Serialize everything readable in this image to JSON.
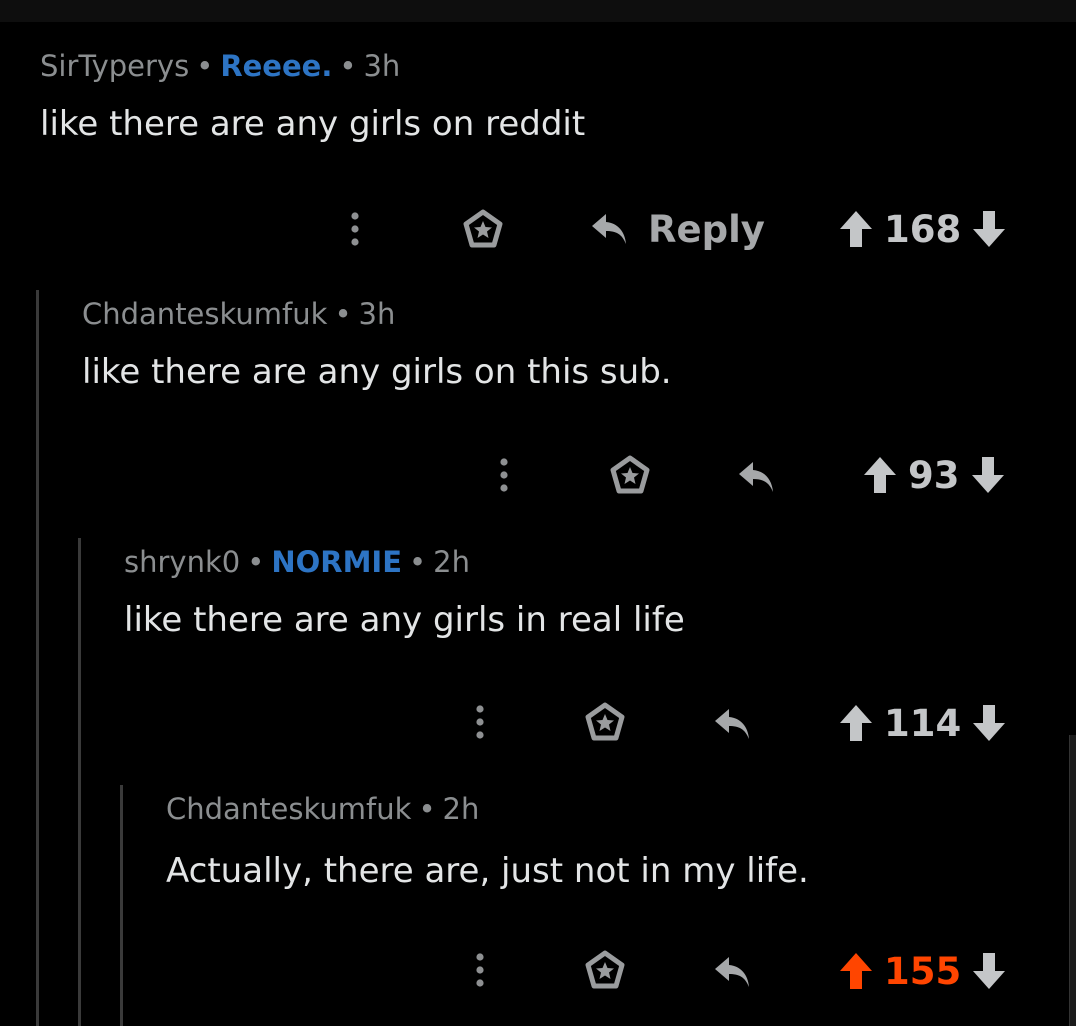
{
  "colors": {
    "background": "#000000",
    "flair": "#2d74c4",
    "upvote_active": "#ff4500",
    "muted": "#8b8e90"
  },
  "comments": [
    {
      "author": "SirTyperys",
      "flair": "Reeee.",
      "age": "3h",
      "body": "like there are any girls on reddit",
      "reply_label": "Reply",
      "score": "168",
      "upvoted": false
    },
    {
      "author": "Chdanteskumfuk",
      "flair": "",
      "age": "3h",
      "body": "like there are any girls on this sub.",
      "reply_label": "",
      "score": "93",
      "upvoted": false
    },
    {
      "author": "shrynk0",
      "flair": "NORMIE",
      "age": "2h",
      "body": "like there are any girls in real life",
      "reply_label": "",
      "score": "114",
      "upvoted": false
    },
    {
      "author": "Chdanteskumfuk",
      "flair": "",
      "age": "2h",
      "body": "Actually, there are, just not in my life.",
      "reply_label": "",
      "score": "155",
      "upvoted": true
    }
  ],
  "icons": {
    "more": "more-options-icon",
    "award": "award-icon",
    "reply": "reply-arrow-icon",
    "upvote": "upvote-arrow-icon",
    "downvote": "downvote-arrow-icon"
  }
}
